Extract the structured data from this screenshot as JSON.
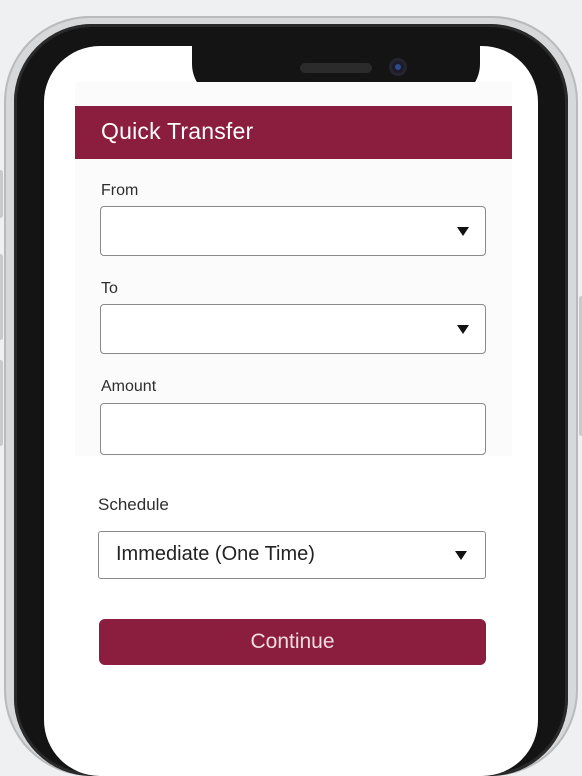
{
  "header": {
    "title": "Quick Transfer"
  },
  "form": {
    "from": {
      "label": "From",
      "value": ""
    },
    "to": {
      "label": "To",
      "value": ""
    },
    "amount": {
      "label": "Amount",
      "value": ""
    },
    "schedule": {
      "label": "Schedule",
      "value": "Immediate (One Time)"
    },
    "continue_label": "Continue"
  },
  "icons": {
    "dropdown": "caret-down-icon"
  },
  "colors": {
    "brand": "#8b1e3f",
    "background": "#eef0f2"
  }
}
